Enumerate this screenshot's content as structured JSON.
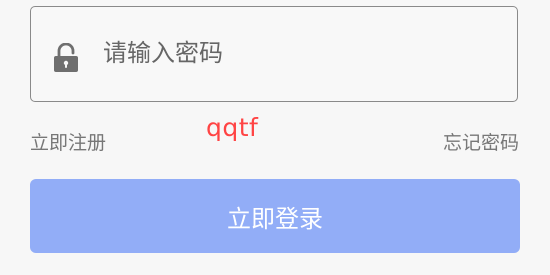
{
  "password": {
    "placeholder": "请输入密码",
    "icon": "lock-open-icon"
  },
  "links": {
    "register": "立即注册",
    "forgot_password": "忘记密码"
  },
  "captcha_text": "qqtf",
  "login_button": {
    "label": "立即登录"
  },
  "colors": {
    "accent": "#92adf7",
    "captcha": "#ff4444",
    "text_muted": "#777777",
    "border": "#8a8a8a"
  }
}
